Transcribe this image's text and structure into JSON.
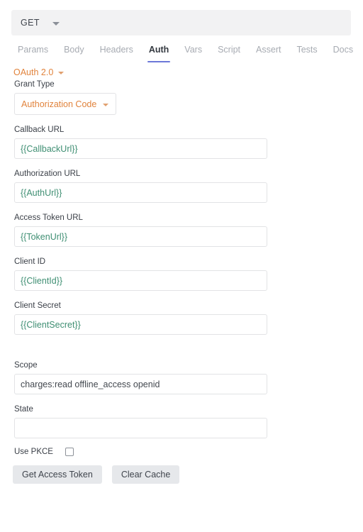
{
  "method_bar": {
    "method": "GET",
    "caret_icon": "chevron-down-icon"
  },
  "tabs": [
    {
      "label": "Params",
      "active": false
    },
    {
      "label": "Body",
      "active": false
    },
    {
      "label": "Headers",
      "active": false
    },
    {
      "label": "Auth",
      "active": true
    },
    {
      "label": "Vars",
      "active": false
    },
    {
      "label": "Script",
      "active": false
    },
    {
      "label": "Assert",
      "active": false
    },
    {
      "label": "Tests",
      "active": false
    },
    {
      "label": "Docs",
      "active": false
    }
  ],
  "auth": {
    "mode_label": "OAuth 2.0",
    "grant_type_label": "Grant Type",
    "grant_type_value": "Authorization Code",
    "fields": [
      {
        "label": "Callback URL",
        "value": "{{CallbackUrl}}",
        "is_variable": true
      },
      {
        "label": "Authorization URL",
        "value": "{{AuthUrl}}",
        "is_variable": true
      },
      {
        "label": "Access Token URL",
        "value": "{{TokenUrl}}",
        "is_variable": true
      },
      {
        "label": "Client ID",
        "value": "{{ClientId}}",
        "is_variable": true
      },
      {
        "label": "Client Secret",
        "value": "{{ClientSecret}}",
        "is_variable": true
      }
    ],
    "scope_label": "Scope",
    "scope_value": "charges:read offline_access openid",
    "state_label": "State",
    "state_value": "",
    "pkce_label": "Use PKCE",
    "pkce_checked": false,
    "get_token_button": "Get Access Token",
    "clear_cache_button": "Clear Cache"
  },
  "colors": {
    "accent_orange": "#e1833c",
    "variable_green": "#3f8f73",
    "active_tab_underline": "#6c78d8",
    "method_bar_bg": "#f2f2f3",
    "button_bg": "#e6e8eb",
    "input_border": "#e2e3e5"
  }
}
